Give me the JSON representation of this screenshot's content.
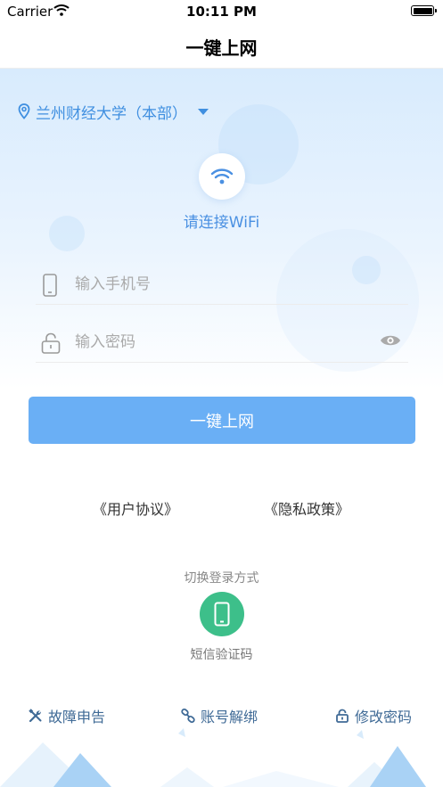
{
  "status_bar": {
    "carrier": "Carrier",
    "time": "10:11 PM"
  },
  "nav": {
    "title": "一键上网"
  },
  "campus": {
    "name": "兰州财经大学（本部）",
    "icon": "location-pin-icon"
  },
  "wifi": {
    "icon": "wifi-icon",
    "label": "请连接WiFi"
  },
  "form": {
    "phone_placeholder": "输入手机号",
    "password_placeholder": "输入密码",
    "submit_label": "一键上网"
  },
  "links": {
    "user_agreement": "《用户协议》",
    "privacy_policy": "《隐私政策》"
  },
  "login_switch": {
    "title": "切换登录方式",
    "sms_label": "短信验证码"
  },
  "bottom_actions": [
    {
      "label": "故障申告",
      "icon": "tools-icon"
    },
    {
      "label": "账号解绑",
      "icon": "unlink-icon"
    },
    {
      "label": "修改密码",
      "icon": "lock-icon"
    }
  ],
  "colors": {
    "accent": "#4a90e2",
    "button": "#6aaff5",
    "sms_green": "#3dbf8a",
    "bottom_text": "#3f6a96"
  }
}
